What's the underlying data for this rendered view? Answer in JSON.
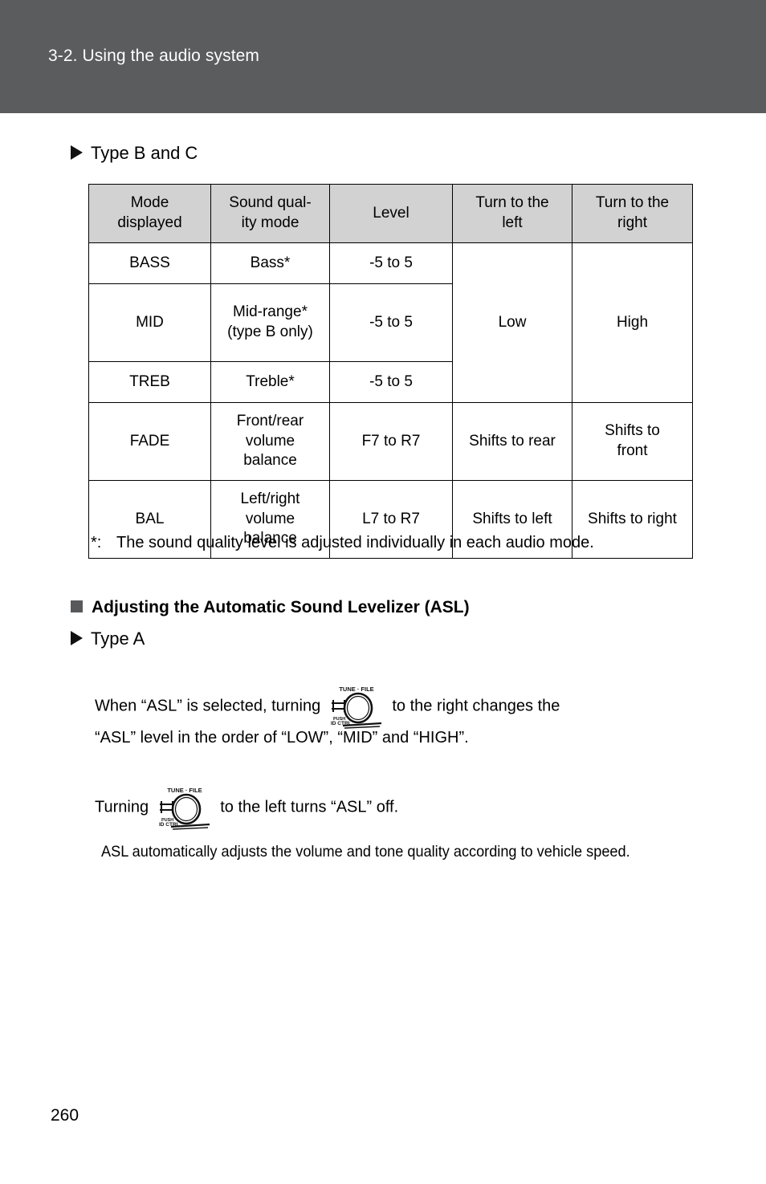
{
  "header": {
    "chapter_title": "3-2. Using the audio system",
    "band_color": "#5b5c5e",
    "text_color": "#ffffff"
  },
  "sections": {
    "type_bc_label": "Type B and C",
    "asl_heading": "Adjusting the Automatic Sound Levelizer (ASL)",
    "type_a_label": "Type A"
  },
  "table": {
    "header_bg": "#d2d2d2",
    "columns": [
      "Mode displayed",
      "Sound qual- ity mode",
      "Level",
      "Turn to the left",
      "Turn to the right"
    ],
    "columns_display": {
      "mode": "Mode\ndisplayed",
      "sound": "Sound qual-\nity mode",
      "level": "Level",
      "left": "Turn to the\nleft",
      "right": "Turn to the\nright"
    },
    "rows": [
      {
        "mode": "BASS",
        "sound": "Bass*",
        "level": "-5 to 5",
        "left": "Low",
        "right": "High"
      },
      {
        "mode": "MID",
        "sound": "Mid-range*\n(type B only)",
        "level": "-5 to 5",
        "left": "",
        "right": ""
      },
      {
        "mode": "TREB",
        "sound": "Treble*",
        "level": "-5 to 5",
        "left": "",
        "right": ""
      },
      {
        "mode": "FADE",
        "sound": "Front/rear\nvolume\nbalance",
        "level": "F7 to R7",
        "left": "Shifts to rear",
        "right": "Shifts to\nfront"
      },
      {
        "mode": "BAL",
        "sound": "Left/right\nvolume\nbalance",
        "level": "L7 to R7",
        "left": "Shifts to left",
        "right": "Shifts to right"
      }
    ],
    "merged_cells": {
      "left_low_rowspan": 3,
      "right_high_rowspan": 3
    }
  },
  "footnote": {
    "marker": "*:",
    "text": "The sound quality level is adjusted individually in each audio mode."
  },
  "paragraphs": {
    "asl_right_before": "When “ASL” is selected, turning",
    "asl_right_after": "to the right changes the",
    "asl_right_line2": "“ASL” level in the order of “LOW”, “MID” and “HIGH”.",
    "asl_left_before": "Turning",
    "asl_left_after": "to the left turns “ASL” off.",
    "asl_note": "ASL automatically adjusts the volume and tone quality according to vehicle speed."
  },
  "knob_icon": {
    "top_label": "TUNE · FILE",
    "bottom_label_1": "PUSH",
    "bottom_label_2": "ID CTRL"
  },
  "page": {
    "number": "260"
  }
}
